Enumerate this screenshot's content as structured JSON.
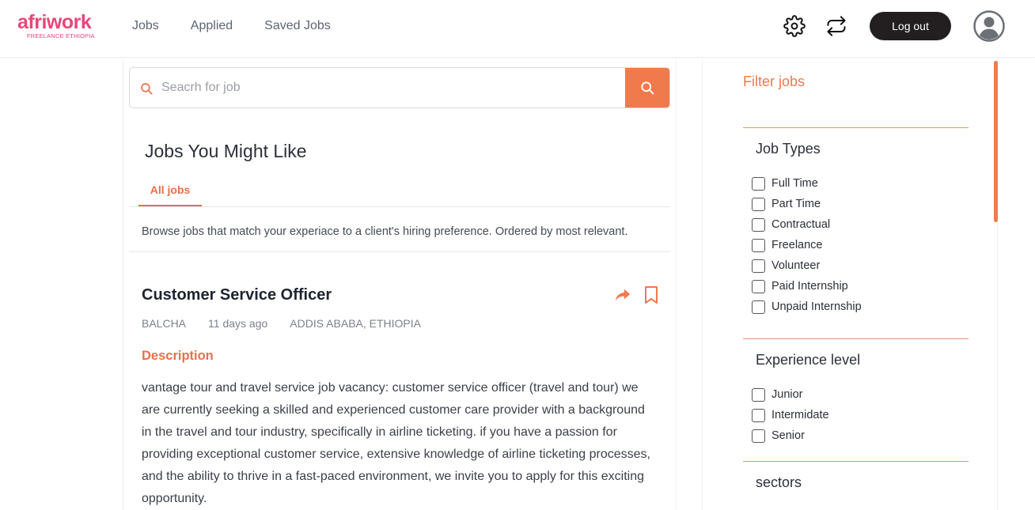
{
  "header": {
    "logo_text": "afriwork",
    "logo_sub": "FREELANCE ETHIOPIA",
    "nav": [
      {
        "label": "Jobs"
      },
      {
        "label": "Applied"
      },
      {
        "label": "Saved Jobs"
      }
    ],
    "logout_label": "Log out"
  },
  "search": {
    "placeholder": "Seacrh for job"
  },
  "section": {
    "title": "Jobs You Might Like",
    "tab_label": "All jobs",
    "browse_text": "Browse jobs that match your experiace to a client's hiring preference. Ordered by most relevant."
  },
  "job": {
    "title": "Customer Service Officer",
    "company": "BALCHA",
    "posted": "11 days ago",
    "location": "ADDIS ABABA, ETHIOPIA",
    "description_heading": "Description",
    "description": "vantage tour and travel service job vacancy: customer service officer (travel and tour) we are currently seeking a skilled and experienced customer care provider with a background in the travel and tour industry, specifically in airline ticketing. if you have a passion for providing exceptional customer service, extensive knowledge of airline ticketing processes, and the ability to thrive in a fast-paced environment, we invite you to apply for this exciting opportunity."
  },
  "filter": {
    "title": "Filter jobs",
    "job_types_heading": "Job Types",
    "job_types": [
      {
        "label": "Full Time"
      },
      {
        "label": "Part Time"
      },
      {
        "label": "Contractual"
      },
      {
        "label": "Freelance"
      },
      {
        "label": "Volunteer"
      },
      {
        "label": "Paid Internship"
      },
      {
        "label": "Unpaid Internship"
      }
    ],
    "experience_heading": "Experience level",
    "experience": [
      {
        "label": "Junior"
      },
      {
        "label": "Intermidate"
      },
      {
        "label": "Senior"
      }
    ],
    "sectors_heading": "sectors"
  },
  "colors": {
    "accent": "#f07a4c",
    "logo_pink": "#e9467a",
    "logout_bg": "#231f20"
  },
  "icons": [
    "settings-gear-icon",
    "switch-role-icon",
    "user-avatar-icon",
    "search-icon",
    "share-icon",
    "bookmark-icon"
  ]
}
